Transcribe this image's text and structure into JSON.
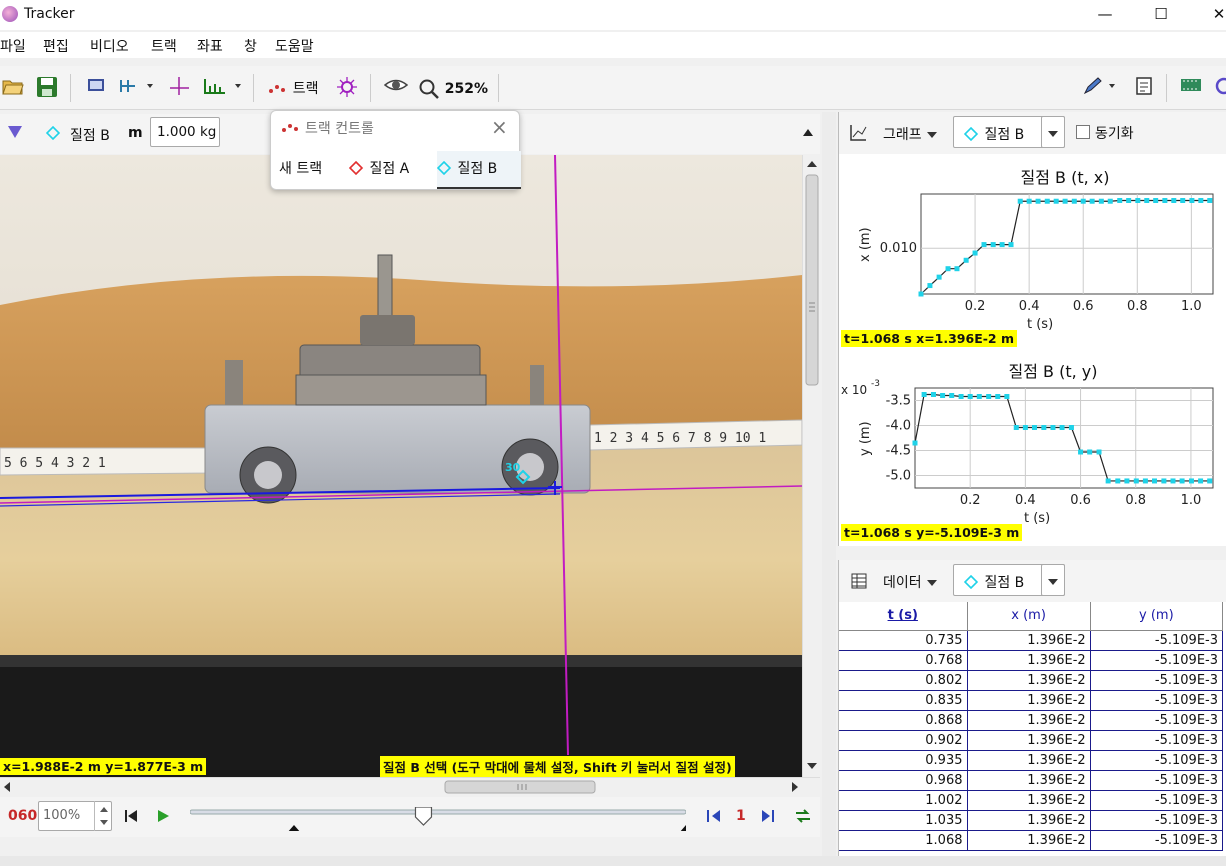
{
  "app": {
    "title": "Tracker",
    "window_buttons": [
      "—",
      "☐",
      "✕"
    ]
  },
  "menu": [
    "파일",
    "편집",
    "비디오",
    "트랙",
    "좌표",
    "창",
    "도움말"
  ],
  "toolbar": {
    "track_label": "트랙",
    "zoom_label": "252%"
  },
  "video_header": {
    "track_name": "질점 B",
    "mass_label": "m",
    "mass_value": "1.000 kg"
  },
  "track_control": {
    "title": "트랙 컨트롤",
    "new_track": "새 트랙",
    "tracks": [
      "질점 A",
      "질점 B"
    ]
  },
  "video": {
    "coord_readout": "x=1.988E-2 m  y=1.877E-3 m",
    "hint": "질점 B 선택 (도구 막대에 물체 설정, Shift 키 눌러서 질점 설정)",
    "point_label": "30",
    "ruler_digits_left": "5 6 5 4 3 2 1",
    "ruler_digits_right": "1 2 3 4 5 6 7 8 9 10 1"
  },
  "player": {
    "frame_start": "060",
    "rate": "100%",
    "step": "1",
    "slider_fraction": 0.47
  },
  "graph_panel": {
    "label": "그래프",
    "track": "질점 B",
    "sync_label": "동기화",
    "graphs": [
      {
        "title": "질점 B (t, x)",
        "ylabel": "x (m)",
        "xlabel": "t (s)",
        "readout": "t=1.068 s  x=1.396E-2 m",
        "yticks": [
          "0.010"
        ],
        "xticks": [
          "0.2",
          "0.4",
          "0.6",
          "0.8",
          "1.0"
        ],
        "multiplier": ""
      },
      {
        "title": "질점 B (t, y)",
        "ylabel": "y (m)",
        "xlabel": "t (s)",
        "readout": "t=1.068 s  y=-5.109E-3 m",
        "yticks": [
          "-3.5",
          "-4.0",
          "-4.5",
          "-5.0"
        ],
        "xticks": [
          "0.2",
          "0.4",
          "0.6",
          "0.8",
          "1.0"
        ],
        "multiplier": "x 10"
      }
    ]
  },
  "data_panel": {
    "label": "데이터",
    "track": "질점 B",
    "columns": [
      "t (s)",
      "x (m)",
      "y (m)"
    ],
    "rows": [
      [
        "0.735",
        "1.396E-2",
        "-5.109E-3"
      ],
      [
        "0.768",
        "1.396E-2",
        "-5.109E-3"
      ],
      [
        "0.802",
        "1.396E-2",
        "-5.109E-3"
      ],
      [
        "0.835",
        "1.396E-2",
        "-5.109E-3"
      ],
      [
        "0.868",
        "1.396E-2",
        "-5.109E-3"
      ],
      [
        "0.902",
        "1.396E-2",
        "-5.109E-3"
      ],
      [
        "0.935",
        "1.396E-2",
        "-5.109E-3"
      ],
      [
        "0.968",
        "1.396E-2",
        "-5.109E-3"
      ],
      [
        "1.002",
        "1.396E-2",
        "-5.109E-3"
      ],
      [
        "1.035",
        "1.396E-2",
        "-5.109E-3"
      ],
      [
        "1.068",
        "1.396E-2",
        "-5.109E-3"
      ]
    ]
  },
  "chart_data": [
    {
      "type": "scatter",
      "title": "질점 B (t, x)",
      "xlabel": "t (s)",
      "ylabel": "x (m)",
      "xlim": [
        0.0,
        1.08
      ],
      "ylim": [
        0.0062,
        0.0145
      ],
      "series": [
        {
          "x": [
            0.0,
            0.033,
            0.067,
            0.1,
            0.133,
            0.167,
            0.2,
            0.233,
            0.267,
            0.3,
            0.333,
            0.367,
            0.4,
            0.433,
            0.467,
            0.5,
            0.533,
            0.567,
            0.6,
            0.633,
            0.667,
            0.7,
            0.735,
            0.768,
            0.802,
            0.835,
            0.868,
            0.902,
            0.935,
            0.968,
            1.002,
            1.035,
            1.068
          ],
          "y": [
            0.0062,
            0.0069,
            0.0076,
            0.0083,
            0.0083,
            0.009,
            0.0096,
            0.0103,
            0.0103,
            0.0103,
            0.0103,
            0.0139,
            0.0139,
            0.0139,
            0.0139,
            0.0139,
            0.0139,
            0.0139,
            0.0139,
            0.0139,
            0.0139,
            0.0139,
            0.01396,
            0.01396,
            0.01396,
            0.01396,
            0.01396,
            0.01396,
            0.01396,
            0.01396,
            0.01396,
            0.01396,
            0.01396
          ]
        }
      ]
    },
    {
      "type": "scatter",
      "title": "질점 B (t, y)",
      "xlabel": "t (s)",
      "ylabel": "y (m)",
      "xlim": [
        0.0,
        1.08
      ],
      "ylim": [
        -0.00525,
        -0.00325
      ],
      "series": [
        {
          "x": [
            0.0,
            0.033,
            0.067,
            0.1,
            0.133,
            0.167,
            0.2,
            0.233,
            0.267,
            0.3,
            0.333,
            0.367,
            0.4,
            0.433,
            0.467,
            0.5,
            0.533,
            0.567,
            0.6,
            0.633,
            0.667,
            0.7,
            0.735,
            0.768,
            0.802,
            0.835,
            0.868,
            0.902,
            0.935,
            0.968,
            1.002,
            1.035,
            1.068
          ],
          "y": [
            -0.00435,
            -0.00338,
            -0.00338,
            -0.0034,
            -0.0034,
            -0.00342,
            -0.00342,
            -0.00342,
            -0.00342,
            -0.00342,
            -0.00342,
            -0.00404,
            -0.00404,
            -0.00404,
            -0.00404,
            -0.00404,
            -0.00404,
            -0.00404,
            -0.00453,
            -0.00453,
            -0.00453,
            -0.005109,
            -0.005109,
            -0.005109,
            -0.005109,
            -0.005109,
            -0.005109,
            -0.005109,
            -0.005109,
            -0.005109,
            -0.005109,
            -0.005109,
            -0.005109
          ]
        }
      ]
    }
  ]
}
